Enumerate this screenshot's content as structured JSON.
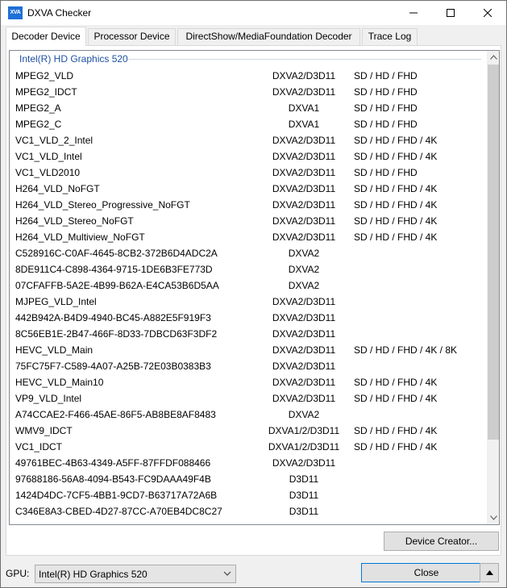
{
  "window": {
    "title": "DXVA Checker",
    "app_icon_text": "XVA"
  },
  "tabs": [
    {
      "label": "Decoder Device",
      "active": true
    },
    {
      "label": "Processor Device",
      "active": false
    },
    {
      "label": "DirectShow/MediaFoundation Decoder",
      "active": false
    },
    {
      "label": "Trace Log",
      "active": false
    }
  ],
  "decoder_list": {
    "group_title": "Intel(R) HD Graphics 520",
    "rows": [
      {
        "name": "MPEG2_VLD",
        "api": "DXVA2/D3D11",
        "res": "SD / HD / FHD"
      },
      {
        "name": "MPEG2_IDCT",
        "api": "DXVA2/D3D11",
        "res": "SD / HD / FHD"
      },
      {
        "name": "MPEG2_A",
        "api": "DXVA1",
        "res": "SD / HD / FHD"
      },
      {
        "name": "MPEG2_C",
        "api": "DXVA1",
        "res": "SD / HD / FHD"
      },
      {
        "name": "VC1_VLD_2_Intel",
        "api": "DXVA2/D3D11",
        "res": "SD / HD / FHD / 4K"
      },
      {
        "name": "VC1_VLD_Intel",
        "api": "DXVA2/D3D11",
        "res": "SD / HD / FHD / 4K"
      },
      {
        "name": "VC1_VLD2010",
        "api": "DXVA2/D3D11",
        "res": "SD / HD / FHD"
      },
      {
        "name": "H264_VLD_NoFGT",
        "api": "DXVA2/D3D11",
        "res": "SD / HD / FHD / 4K"
      },
      {
        "name": "H264_VLD_Stereo_Progressive_NoFGT",
        "api": "DXVA2/D3D11",
        "res": "SD / HD / FHD / 4K"
      },
      {
        "name": "H264_VLD_Stereo_NoFGT",
        "api": "DXVA2/D3D11",
        "res": "SD / HD / FHD / 4K"
      },
      {
        "name": "H264_VLD_Multiview_NoFGT",
        "api": "DXVA2/D3D11",
        "res": "SD / HD / FHD / 4K"
      },
      {
        "name": "C528916C-C0AF-4645-8CB2-372B6D4ADC2A",
        "api": "DXVA2",
        "res": ""
      },
      {
        "name": "8DE911C4-C898-4364-9715-1DE6B3FE773D",
        "api": "DXVA2",
        "res": ""
      },
      {
        "name": "07CFAFFB-5A2E-4B99-B62A-E4CA53B6D5AA",
        "api": "DXVA2",
        "res": ""
      },
      {
        "name": "MJPEG_VLD_Intel",
        "api": "DXVA2/D3D11",
        "res": ""
      },
      {
        "name": "442B942A-B4D9-4940-BC45-A882E5F919F3",
        "api": "DXVA2/D3D11",
        "res": ""
      },
      {
        "name": "8C56EB1E-2B47-466F-8D33-7DBCD63F3DF2",
        "api": "DXVA2/D3D11",
        "res": ""
      },
      {
        "name": "HEVC_VLD_Main",
        "api": "DXVA2/D3D11",
        "res": "SD / HD / FHD / 4K / 8K"
      },
      {
        "name": "75FC75F7-C589-4A07-A25B-72E03B0383B3",
        "api": "DXVA2/D3D11",
        "res": ""
      },
      {
        "name": "HEVC_VLD_Main10",
        "api": "DXVA2/D3D11",
        "res": "SD / HD / FHD / 4K"
      },
      {
        "name": "VP9_VLD_Intel",
        "api": "DXVA2/D3D11",
        "res": "SD / HD / FHD / 4K"
      },
      {
        "name": "A74CCAE2-F466-45AE-86F5-AB8BE8AF8483",
        "api": "DXVA2",
        "res": ""
      },
      {
        "name": "WMV9_IDCT",
        "api": "DXVA1/2/D3D11",
        "res": "SD / HD / FHD / 4K"
      },
      {
        "name": "VC1_IDCT",
        "api": "DXVA1/2/D3D11",
        "res": "SD / HD / FHD / 4K"
      },
      {
        "name": "49761BEC-4B63-4349-A5FF-87FFDF088466",
        "api": "DXVA2/D3D11",
        "res": ""
      },
      {
        "name": "97688186-56A8-4094-B543-FC9DAAA49F4B",
        "api": "D3D11",
        "res": ""
      },
      {
        "name": "1424D4DC-7CF5-4BB1-9CD7-B63717A72A6B",
        "api": "D3D11",
        "res": ""
      },
      {
        "name": "C346E8A3-CBED-4D27-87CC-A70EB4DC8C27",
        "api": "D3D11",
        "res": ""
      }
    ]
  },
  "buttons": {
    "device_creator": "Device Creator...",
    "close": "Close"
  },
  "gpu": {
    "label": "GPU:",
    "selected": "Intel(R) HD Graphics 520"
  },
  "icons": {
    "minimize": "minimize-icon",
    "maximize": "maximize-icon",
    "close": "close-icon",
    "scroll_up": "chevron-up-icon",
    "scroll_down": "chevron-down-icon",
    "dropdown": "chevron-down-icon",
    "collapse": "triangle-up-icon"
  },
  "colors": {
    "accent": "#0078d7",
    "group_title": "#1e50a2",
    "app_icon": "#1e6fd8"
  }
}
